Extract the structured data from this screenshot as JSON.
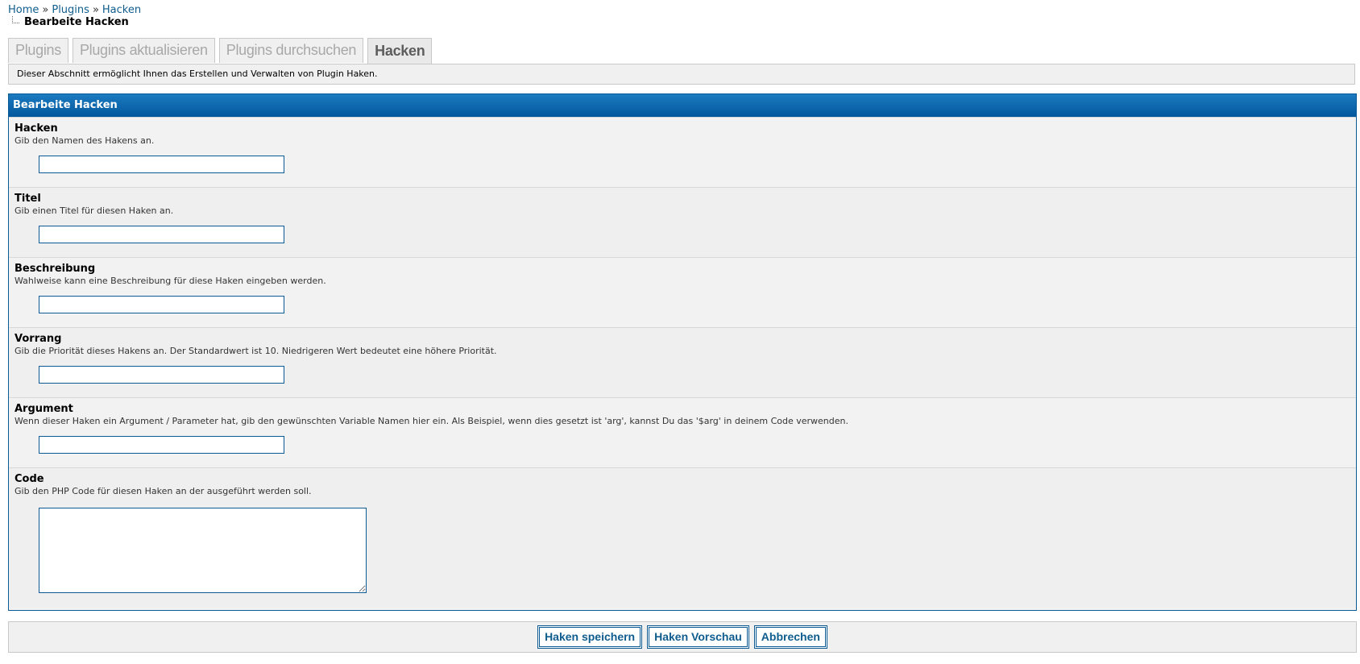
{
  "breadcrumb": {
    "home": "Home",
    "sep1": "»",
    "plugins": "Plugins",
    "sep2": "»",
    "hooks": "Hacken"
  },
  "current_page": "Bearbeite Hacken",
  "tabs": [
    {
      "label": "Plugins",
      "active": false
    },
    {
      "label": "Plugins aktualisieren",
      "active": false
    },
    {
      "label": "Plugins durchsuchen",
      "active": false
    },
    {
      "label": "Hacken",
      "active": true
    }
  ],
  "intro_text": "Dieser Abschnitt ermöglicht Ihnen das Erstellen und Verwalten von Plugin Haken.",
  "form": {
    "title": "Bearbeite Hacken",
    "fields": [
      {
        "label": "Hacken",
        "desc": "Gib den Namen des Hakens an.",
        "value": ""
      },
      {
        "label": "Titel",
        "desc": "Gib einen Titel für diesen Haken an.",
        "value": ""
      },
      {
        "label": "Beschreibung",
        "desc": "Wahlweise kann eine Beschreibung für diese Haken eingeben werden.",
        "value": ""
      },
      {
        "label": "Vorrang",
        "desc": "Gib die Priorität dieses Hakens an. Der Standardwert ist 10. Niedrigeren Wert bedeutet eine höhere Priorität.",
        "value": ""
      },
      {
        "label": "Argument",
        "desc": "Wenn dieser Haken ein Argument / Parameter hat, gib den gewünschten Variable Namen hier ein. Als Beispiel, wenn dies gesetzt ist 'arg', kannst Du das '$arg' in deinem Code verwenden.",
        "value": ""
      },
      {
        "label": "Code",
        "desc": "Gib den PHP Code für diesen Haken an der ausgeführt werden soll.",
        "value": ""
      }
    ]
  },
  "actions": {
    "save": "Haken speichern",
    "preview": "Haken Vorschau",
    "cancel": "Abbrechen"
  },
  "colors": {
    "accent": "#0a5a96",
    "link": "#0f5c8e",
    "panel_bg": "#f0f0f0"
  }
}
